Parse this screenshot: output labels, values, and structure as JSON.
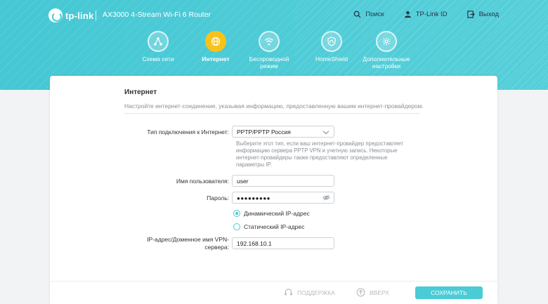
{
  "header": {
    "brand": "tp-link",
    "model": "AX3000 4-Stream Wi-Fi 6 Router",
    "links": [
      {
        "label": "Поиск",
        "icon": "search-icon"
      },
      {
        "label": "TP-Link ID",
        "icon": "user-icon"
      },
      {
        "label": "Выход",
        "icon": "logout-icon"
      }
    ]
  },
  "nav": [
    {
      "label": "Схема сети",
      "icon": "network-map-icon"
    },
    {
      "label": "Интернет",
      "icon": "globe-icon",
      "active": true
    },
    {
      "label": "Беспроводной режим",
      "icon": "wifi-icon"
    },
    {
      "label": "HomeShield",
      "icon": "shield-home-icon"
    },
    {
      "label": "Дополнительные настройки",
      "icon": "gear-icon"
    }
  ],
  "form": {
    "title": "Интернет",
    "description": "Настройте интернет-соединение, указывая информацию, предоставленную вашим интернет-провайдером.",
    "connection_type_label": "Тип подключения к Интернет:",
    "connection_type_value": "PPTP/PPTP Россия",
    "hint": "Выберите этот тип, если ваш интернет-провайдер предоставляет информацию сервера PPTP VPN и учетную запись. Некоторые интернет-провайдеры также предоставляют определенные параметры IP.",
    "username_label": "Имя пользователя:",
    "username_value": "user",
    "password_label": "Пароль:",
    "password_value": "●●●●●●●●●",
    "radio_dynamic": "Динамический IP-адрес",
    "radio_static": "Статический IP-адрес",
    "vpn_label": "IP-адрес/Доменное имя VPN-сервера:",
    "vpn_value": "192.168.10.1"
  },
  "footer": {
    "support": "ПОДДЕРЖКА",
    "up": "ВВЕРХ",
    "save": "СОХРАНИТЬ"
  },
  "colors": {
    "accent": "#4acbd6",
    "active_tab": "#f7c31a"
  }
}
